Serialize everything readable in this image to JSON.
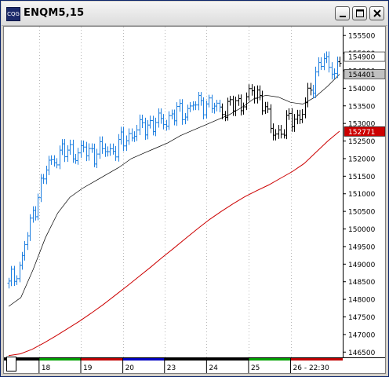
{
  "window": {
    "title": "ENQM5,15",
    "icon": "cqg-logo",
    "icon_text": "CQG",
    "buttons": [
      "minimize-icon",
      "maximize-icon",
      "close-icon"
    ]
  },
  "chart_data": {
    "type": "ohlc",
    "symbol": "ENQM5",
    "interval": "15",
    "ylim": [
      146350,
      155750
    ],
    "y_ticks": [
      146500,
      147000,
      147500,
      148000,
      148500,
      149000,
      149500,
      150000,
      150500,
      151000,
      151500,
      152000,
      152500,
      153000,
      153500,
      154000,
      154500,
      155000,
      155500
    ],
    "price_labels": [
      {
        "value": 154900,
        "text": "154900",
        "color": "#000000",
        "bg": "#ffffff"
      },
      {
        "value": 154401,
        "text": "154401",
        "color": "#000000",
        "bg": "#c0c0c0"
      },
      {
        "value": 152771,
        "text": "152771",
        "color": "#ffffff",
        "bg": "#cc0000"
      }
    ],
    "x_labels": [
      {
        "text": "18",
        "t": 0.092
      },
      {
        "text": "19",
        "t": 0.218
      },
      {
        "text": "20",
        "t": 0.345
      },
      {
        "text": "23",
        "t": 0.471
      },
      {
        "text": "24",
        "t": 0.598
      },
      {
        "text": "25",
        "t": 0.725
      },
      {
        "text": "26 - 22:30",
        "t": 0.852
      }
    ],
    "session_colors": [
      "#00a000",
      "#c00000",
      "#0000c0",
      "#000000",
      "#000000",
      "#00a000",
      "#c00000"
    ],
    "series": [
      {
        "name": "",
        "color": "#000000",
        "kind": "average",
        "values": [
          147800,
          148050,
          148850,
          149750,
          150450,
          150900,
          151150,
          151350,
          151550,
          151750,
          152000,
          152150,
          152300,
          152450,
          152650,
          152800,
          152950,
          153100,
          153250,
          153450,
          153700,
          153800,
          153750,
          153600,
          153550,
          153750,
          154050,
          154400
        ]
      },
      {
        "name": "",
        "color": "#cc0000",
        "kind": "average",
        "values": [
          146400,
          146450,
          146580,
          146760,
          146960,
          147170,
          147380,
          147610,
          147850,
          148110,
          148370,
          148640,
          148910,
          149190,
          149460,
          149740,
          150010,
          150270,
          150500,
          150720,
          150920,
          151090,
          151250,
          151440,
          151630,
          151860,
          152180,
          152500,
          152780
        ]
      }
    ],
    "bars_up_color": "#2080e0",
    "bars_down_color": "#000000"
  }
}
